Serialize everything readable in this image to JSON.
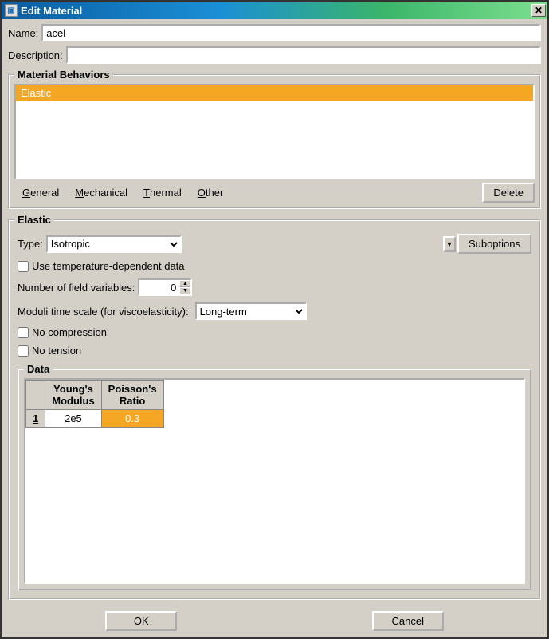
{
  "window": {
    "title": "Edit Material"
  },
  "fields": {
    "name_label": "Name:",
    "name_value": "acel",
    "desc_label": "Description:",
    "desc_value": ""
  },
  "behaviors": {
    "legend": "Material Behaviors",
    "items": [
      "Elastic"
    ],
    "selected": 0,
    "menus": {
      "general": "General",
      "mechanical": "Mechanical",
      "thermal": "Thermal",
      "other": "Other"
    },
    "delete": "Delete"
  },
  "elastic": {
    "legend": "Elastic",
    "type_label": "Type:",
    "type_value": "Isotropic",
    "suboptions": "Suboptions",
    "temp_dep_label": "Use temperature-dependent data",
    "temp_dep_checked": false,
    "field_vars_label": "Number of field variables:",
    "field_vars_value": "0",
    "moduli_label": "Moduli time scale (for viscoelasticity):",
    "moduli_value": "Long-term",
    "no_compression_label": "No compression",
    "no_compression_checked": false,
    "no_tension_label": "No tension",
    "no_tension_checked": false,
    "data": {
      "legend": "Data",
      "headers": {
        "col1a": "Young's",
        "col1b": "Modulus",
        "col2a": "Poisson's",
        "col2b": "Ratio"
      },
      "rows": [
        {
          "n": "1",
          "youngs": "2e5",
          "poisson": "0.3"
        }
      ]
    }
  },
  "buttons": {
    "ok": "OK",
    "cancel": "Cancel"
  }
}
